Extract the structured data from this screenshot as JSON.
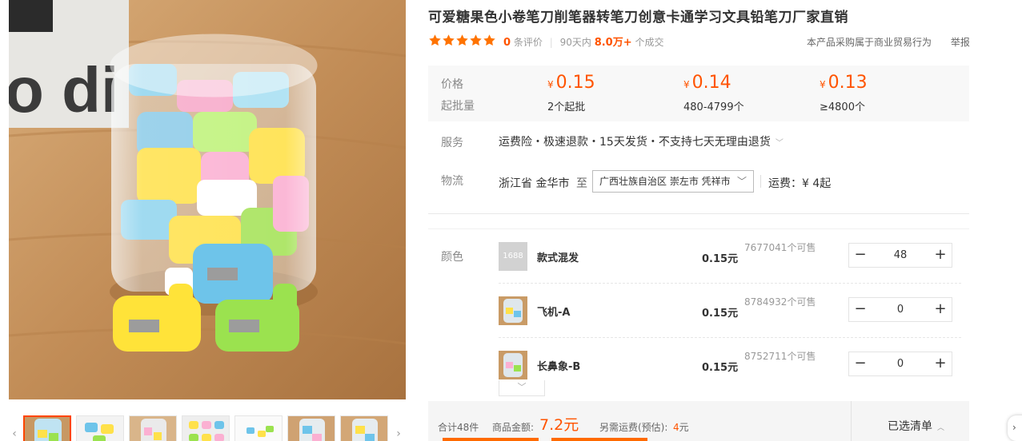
{
  "product": {
    "title": "可爱糖果色小卷笔刀削笔器转笔刀创意卡通学习文具铅笔刀厂家直销",
    "rating_stars": 5,
    "review_count": "0",
    "review_suffix": "条评价",
    "deal_period": "90天内",
    "deal_count": "8.0万+",
    "deal_suffix": "个成交",
    "procurement_note": "本产品采购属于商业贸易行为",
    "report_label": "举报"
  },
  "pricing": {
    "price_label": "价格",
    "moq_label": "起批量",
    "currency": "¥",
    "tiers": [
      {
        "price": "0.15",
        "moq": "2个起批"
      },
      {
        "price": "0.14",
        "moq": "480-4799个"
      },
      {
        "price": "0.13",
        "moq": "≥4800个"
      }
    ]
  },
  "service": {
    "label": "服务",
    "text": "运费险・极速退款・15天发货・不支持七天无理由退货"
  },
  "logistics": {
    "label": "物流",
    "from": "浙江省 金华市",
    "to_label": "至",
    "destination": "广西壮族自治区 崇左市 凭祥市",
    "freight": "运费：¥ 4起"
  },
  "sku": {
    "color_label": "颜色",
    "placeholder_logo": "1688",
    "items": [
      {
        "name": "款式混发",
        "price": "0.15元",
        "stock": "7677041个可售",
        "qty": "48"
      },
      {
        "name": "飞机-A",
        "price": "0.15元",
        "stock": "8784932个可售",
        "qty": "0"
      },
      {
        "name": "长鼻象-B",
        "price": "0.15元",
        "stock": "8752711个可售",
        "qty": "0"
      }
    ],
    "minus": "−",
    "plus": "+"
  },
  "summary": {
    "total_text": "合计48件",
    "amount_label": "商品金额:",
    "amount": "7.2元",
    "shipping_label": "另需运费(预估):",
    "shipping_value": "4",
    "shipping_unit": "元",
    "selected_list": "已选清单"
  },
  "icons": {
    "star": "star-icon",
    "chevron_down": "chevron-down-icon",
    "chevron_up": "chevron-up-icon",
    "arrow_left": "arrow-left-icon",
    "arrow_right": "arrow-right-icon"
  },
  "colors": {
    "accent": "#ff5400",
    "star": "#ff7300",
    "bar": "#ff6a00"
  }
}
